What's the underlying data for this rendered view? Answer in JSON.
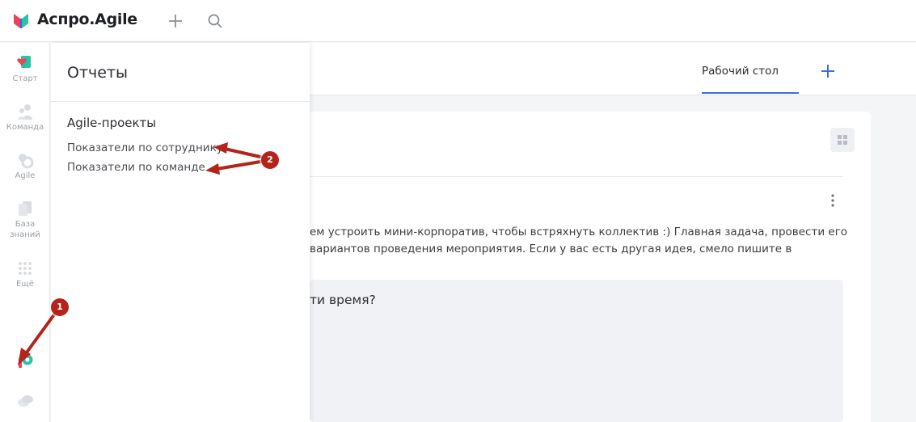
{
  "app": {
    "brand": "Аспро.Agile",
    "accent_color": "#3a6fd8",
    "annotation_color": "#b3241b"
  },
  "topbar": {
    "icons": [
      "add-icon",
      "search-icon"
    ]
  },
  "leftnav": {
    "items": [
      {
        "label": "Старт",
        "icon": "start-icon"
      },
      {
        "label": "Команда",
        "icon": "team-icon"
      },
      {
        "label": "Agile",
        "icon": "agile-icon"
      },
      {
        "label": "База",
        "label2": "знаний",
        "icon": "knowledge-base-icon"
      },
      {
        "label": "Ещё",
        "icon": "more-grid-icon"
      }
    ],
    "bottom_icons": [
      "reports-icon",
      "chat-icon"
    ]
  },
  "reports_panel": {
    "title": "Отчеты",
    "section": "Agile-проекты",
    "links": [
      "Показатели по сотруднику",
      "Показатели по команде"
    ]
  },
  "tabs": {
    "active": "Рабочий стол"
  },
  "post": {
    "line1": "ем устроить мини-корпоратив, чтобы встряхнуть коллектив :) Главная задача, провести его",
    "line2": "вариантов проведения мероприятия. Если у вас есть другая идея, смело пишите в",
    "poll_question": "ти время?"
  },
  "annotations": {
    "badge1": "1",
    "badge2": "2"
  }
}
